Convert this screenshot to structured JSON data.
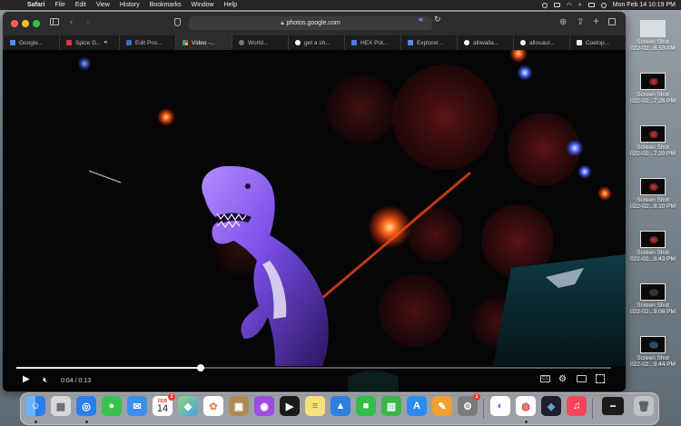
{
  "menubar": {
    "app_name": "Safari",
    "items": [
      "File",
      "Edit",
      "View",
      "History",
      "Bookmarks",
      "Window",
      "Help"
    ],
    "clock": "Mon Feb 14  10:19 PM"
  },
  "toolbar": {
    "url": "photos.google.com"
  },
  "tabs": [
    {
      "label": "Google...",
      "favicon_color": "#4a8ef0",
      "active": false
    },
    {
      "label": "Spice G...",
      "favicon_color": "#e5333f",
      "active": false,
      "audio": true
    },
    {
      "label": "Edit Pos...",
      "favicon_color": "#2e73c8",
      "active": false
    },
    {
      "label": "Video -...",
      "favicon_color": "#f4b400",
      "active": true
    },
    {
      "label": "World...",
      "favicon_color": "#777777",
      "active": false
    },
    {
      "label": "get a sh...",
      "favicon_color": "#ffffff",
      "active": false
    },
    {
      "label": "HEX Pot...",
      "favicon_color": "#4a7ee0",
      "active": false
    },
    {
      "label": "Explorer...",
      "favicon_color": "#5a8ee8",
      "active": false
    },
    {
      "label": "alliwalla...",
      "favicon_color": "#ffffff",
      "active": false
    },
    {
      "label": "allosaur...",
      "favicon_color": "#ffffff",
      "active": false
    },
    {
      "label": "Coelop...",
      "favicon_color": "#e8e8e8",
      "active": false
    }
  ],
  "video": {
    "current_time": "0:04",
    "duration": "0:13",
    "time_display": "0:04 / 0:13",
    "progress_fraction": 0.31
  },
  "desktop_items": [
    {
      "line1": "Screen Shot",
      "line2": "022-02...6.53 AM",
      "thumb": "light"
    },
    {
      "line1": "Screen Shot",
      "line2": "022-02...7.26 PM",
      "thumb": "dark"
    },
    {
      "line1": "Screen Shot",
      "line2": "022-02...7.20 PM",
      "thumb": "dark"
    },
    {
      "line1": "Screen Shot",
      "line2": "022-02...8.10 PM",
      "thumb": "dark"
    },
    {
      "line1": "Screen Shot",
      "line2": "022-02...8.43 PM",
      "thumb": "dark"
    },
    {
      "line1": "Screen Shot",
      "line2": "022-02...9.06 PM",
      "thumb": "dark"
    },
    {
      "line1": "Screen Shot",
      "line2": "022-02...9.44 PM",
      "thumb": "dark"
    }
  ],
  "dock": {
    "calendar_month": "FEB",
    "calendar_day": "14",
    "calendar_badge": "2",
    "settings_badge": "1",
    "apps": [
      {
        "name": "finder-icon",
        "color": "#3c8ff0",
        "glyph": "☺"
      },
      {
        "name": "launchpad-icon",
        "color": "#e0e0e0",
        "glyph": "▦"
      },
      {
        "name": "safari-icon",
        "color": "#2c7ee8",
        "glyph": "◎"
      },
      {
        "name": "messages-icon",
        "color": "#37c24e",
        "glyph": "●"
      },
      {
        "name": "mail-icon",
        "color": "#3b8ef0",
        "glyph": "✉"
      },
      {
        "name": "calendar-icon",
        "color": "#ffffff",
        "glyph": ""
      },
      {
        "name": "maps-icon",
        "color": "#58b862",
        "glyph": "◆"
      },
      {
        "name": "photos-icon",
        "color": "#ffffff",
        "glyph": "✿"
      },
      {
        "name": "keychain-icon",
        "color": "#b08a55",
        "glyph": "▣"
      },
      {
        "name": "podcasts-icon",
        "color": "#9b4de0",
        "glyph": "◉"
      },
      {
        "name": "tv-icon",
        "color": "#1a1a1a",
        "glyph": "▶"
      },
      {
        "name": "notes-icon",
        "color": "#f7e07a",
        "glyph": "≡"
      },
      {
        "name": "keynote-icon",
        "color": "#2f7ee0",
        "glyph": "▲"
      },
      {
        "name": "facetime-icon",
        "color": "#2fbf4a",
        "glyph": "■"
      },
      {
        "name": "numbers-icon",
        "color": "#3bb54a",
        "glyph": "▥"
      },
      {
        "name": "app-store-icon",
        "color": "#2c8af0",
        "glyph": "A"
      },
      {
        "name": "pages-icon",
        "color": "#f0a030",
        "glyph": "✎"
      },
      {
        "name": "system-preferences-icon",
        "color": "#7a7a7a",
        "glyph": "⚙"
      },
      {
        "name": "messenger-icon",
        "color": "#ffffff",
        "glyph": "◐"
      },
      {
        "name": "chrome-icon",
        "color": "#ffffff",
        "glyph": "◍"
      },
      {
        "name": "davinci-resolve-icon",
        "color": "#1e1e2e",
        "glyph": "◈"
      },
      {
        "name": "music-icon",
        "color": "#f5455c",
        "glyph": "♫"
      }
    ]
  }
}
